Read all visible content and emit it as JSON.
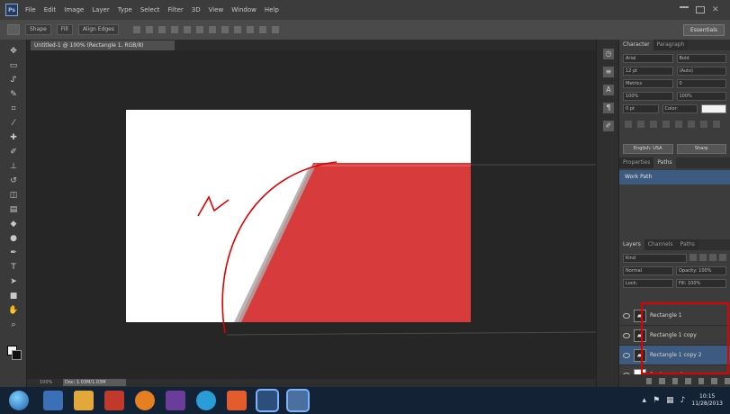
{
  "app": {
    "logo_text": "Ps",
    "menu": [
      "File",
      "Edit",
      "Image",
      "Layer",
      "Type",
      "Select",
      "Filter",
      "3D",
      "View",
      "Window",
      "Help"
    ]
  },
  "options_bar": {
    "mode_label": "Shape",
    "fill_label": "Fill",
    "align_label": "Align Edges",
    "workspace_label": "Essentials"
  },
  "document": {
    "tab_title": "Untitled-1 @ 100% (Rectangle 1, RGB/8)",
    "zoom": "100%",
    "status_info": "Doc: 1.03M/1.03M"
  },
  "character_panel": {
    "tabs": [
      "Character",
      "Paragraph"
    ],
    "font_family": "Arial",
    "font_style": "Bold",
    "font_size": "12 pt",
    "leading": "(Auto)",
    "kerning": "Metrics",
    "tracking": "0",
    "vertical_scale": "100%",
    "horizontal_scale": "100%",
    "baseline_shift": "0 pt",
    "color_label": "Color:",
    "lang": "English: USA",
    "aa": "Sharp"
  },
  "paths_panel": {
    "tabs": [
      "Properties",
      "Paths"
    ],
    "item": "Work Path"
  },
  "layers_panel": {
    "tabs": [
      "Layers",
      "Channels",
      "Paths"
    ],
    "kind": "Kind",
    "blend_mode": "Normal",
    "opacity": "Opacity: 100%",
    "lock": "Lock:",
    "fill": "Fill: 100%",
    "layers": [
      {
        "name": "Rectangle 1",
        "selected": false,
        "thumb": "shape"
      },
      {
        "name": "Rectangle 1 copy",
        "selected": false,
        "thumb": "shape"
      },
      {
        "name": "Rectangle 1 copy 2",
        "selected": true,
        "thumb": "shape"
      },
      {
        "name": "Background",
        "selected": false,
        "thumb": "white"
      }
    ]
  },
  "colors": {
    "red_shape": "#d83b3b",
    "annotation": "#e10000",
    "selection": "#3d5a80"
  },
  "taskbar": {
    "clock_time": "10:15",
    "clock_date": "11/28/2013"
  }
}
